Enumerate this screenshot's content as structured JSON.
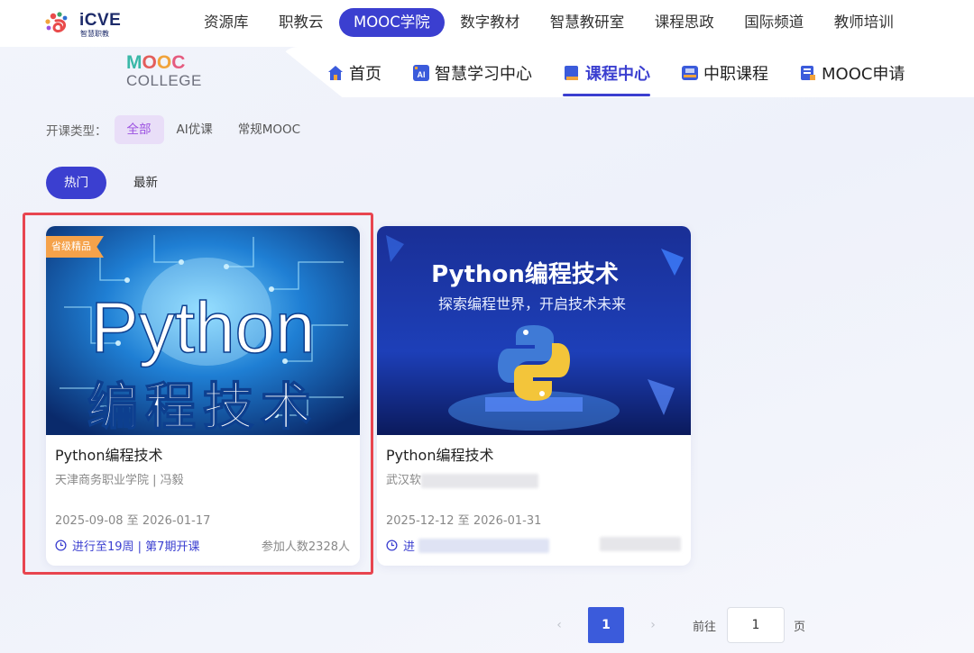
{
  "brand": {
    "name": "iCVE",
    "sub": "智慧职教"
  },
  "topnav": [
    "资源库",
    "职教云",
    "MOOC学院",
    "数字教材",
    "智慧教研室",
    "课程思政",
    "国际频道",
    "教师培训"
  ],
  "topnav_active": "MOOC学院",
  "mooc_logo": {
    "letters": [
      "M",
      "O",
      "O",
      "C"
    ],
    "word": "COLLEGE"
  },
  "subnav": [
    {
      "label": "首页",
      "icon": "home-icon"
    },
    {
      "label": "智慧学习中心",
      "icon": "ai-icon"
    },
    {
      "label": "课程中心",
      "icon": "book-icon"
    },
    {
      "label": "中职课程",
      "icon": "vocational-icon"
    },
    {
      "label": "MOOC申请",
      "icon": "apply-icon"
    }
  ],
  "subnav_active": "课程中心",
  "filters": {
    "label": "开课类型：",
    "options": [
      "全部",
      "AI优课",
      "常规MOOC"
    ],
    "active": "全部"
  },
  "sort": {
    "options": [
      "热门",
      "最新"
    ],
    "active": "热门"
  },
  "courses": [
    {
      "badge": "省级精品",
      "cover_title": "Python",
      "cover_subtitle": "编程技术",
      "title": "Python编程技术",
      "org": "天津商务职业学院 | 冯毅",
      "date": "2025-09-08 至 2026-01-17",
      "status": "进行至19周 | 第7期开课",
      "count": "参加人数2328人"
    },
    {
      "cover_title": "Python编程技术",
      "cover_subtitle": "探索编程世界，开启技术未来",
      "title": "Python编程技术",
      "org": "武汉软",
      "date": "2025-12-12 至 2026-01-31",
      "status": "进"
    }
  ],
  "pagination": {
    "prev": "‹",
    "current": "1",
    "next": "›",
    "goto_label": "前往",
    "goto_value": "1",
    "unit": "页"
  },
  "colors": {
    "primary": "#3b3fd0",
    "highlight": "#e8454f",
    "badge": "#f5a24a"
  }
}
